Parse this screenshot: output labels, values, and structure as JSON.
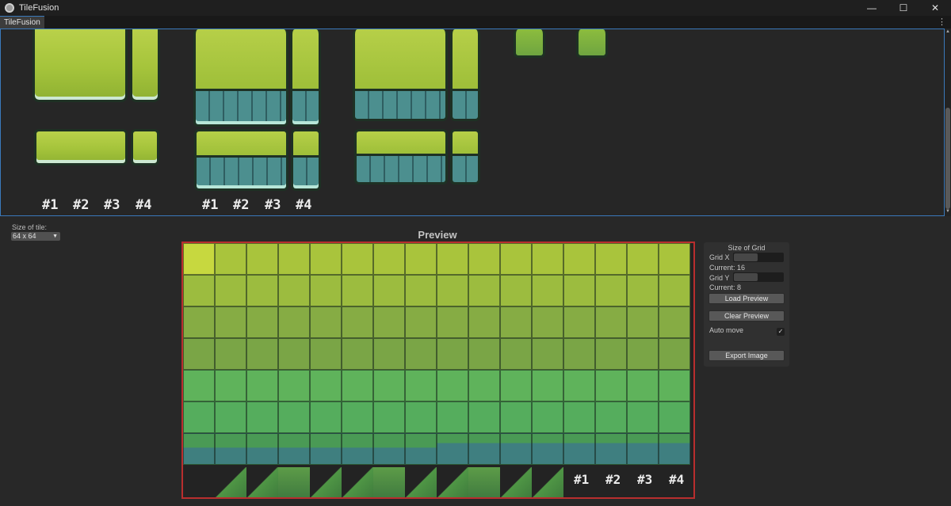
{
  "window": {
    "title": "TileFusion",
    "controls": {
      "minimize": "—",
      "maximize": "☐",
      "close": "✕"
    }
  },
  "tabs": [
    {
      "label": "TileFusion"
    }
  ],
  "tab_menu_icon": "kebab-menu-icon",
  "tileset": {
    "labels_group_1": [
      "#1",
      "#2",
      "#3",
      "#4"
    ],
    "labels_group_2": [
      "#1",
      "#2",
      "#3",
      "#4"
    ]
  },
  "tile_size": {
    "label": "Size of tile:",
    "value": "64 x 64"
  },
  "preview": {
    "title": "Preview",
    "bottom_labels": [
      "#1",
      "#2",
      "#3",
      "#4"
    ]
  },
  "grid_panel": {
    "title": "Size of Grid",
    "grid_x_label": "Grid X",
    "grid_x_current": "Current: 16",
    "grid_y_label": "Grid Y",
    "grid_y_current": "Current: 8",
    "load_button": "Load Preview",
    "clear_button": "Clear Preview",
    "auto_move_label": "Auto move",
    "auto_move_checked": "✓",
    "export_button": "Export Image"
  },
  "colors": {
    "accent_blue": "#3a79bb",
    "preview_border": "#b92e2e",
    "background": "#282828"
  }
}
